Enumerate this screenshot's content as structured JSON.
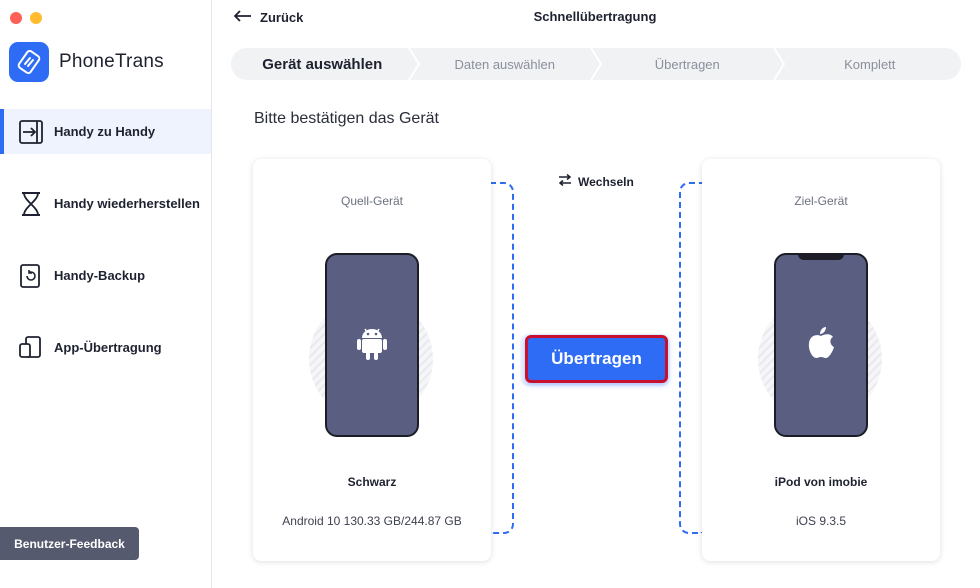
{
  "app": {
    "name": "PhoneTrans",
    "title": "Schnellübertragung",
    "back_label": "Zurück",
    "accent_color": "#2f6cf5"
  },
  "sidebar": {
    "items": [
      {
        "label": "Handy zu Handy",
        "icon": "phone-to-phone-icon",
        "active": true
      },
      {
        "label": "Handy wiederherstellen",
        "icon": "hourglass-icon",
        "active": false
      },
      {
        "label": "Handy-Backup",
        "icon": "backup-icon",
        "active": false
      },
      {
        "label": "App-Übertragung",
        "icon": "app-transfer-icon",
        "active": false
      }
    ],
    "feedback_label": "Benutzer-Feedback"
  },
  "steps": [
    {
      "label": "Gerät auswählen",
      "current": true
    },
    {
      "label": "Daten auswählen",
      "current": false
    },
    {
      "label": "Übertragen",
      "current": false
    },
    {
      "label": "Komplett",
      "current": false
    }
  ],
  "main": {
    "heading": "Bitte bestätigen das Gerät",
    "switch_label": "Wechseln",
    "transfer_label": "Übertragen",
    "source": {
      "label": "Quell-Gerät",
      "name": "Schwarz",
      "info": "Android 10 130.33 GB/244.87 GB",
      "icon": "android-icon"
    },
    "target": {
      "label": "Ziel-Gerät",
      "name": "iPod von imobie",
      "info": "iOS 9.3.5",
      "icon": "apple-icon"
    }
  }
}
